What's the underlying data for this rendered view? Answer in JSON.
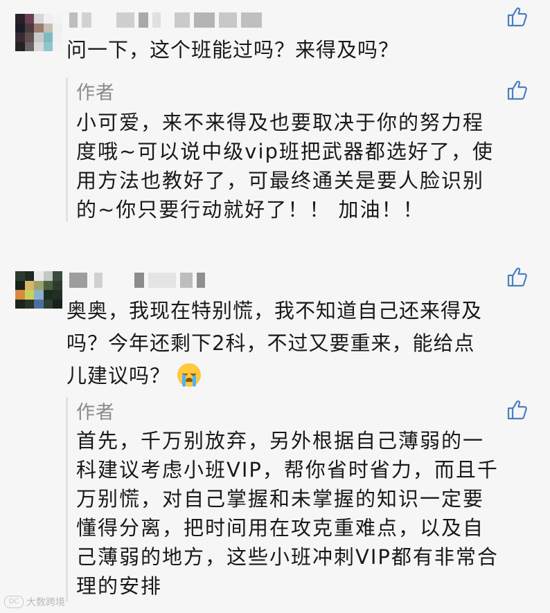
{
  "comments": [
    {
      "nickname": "",
      "text": "问一下，这个班能过吗？来得及吗？",
      "reply": {
        "author": "作者",
        "text": "小可爱，来不来得及也要取决于你的努力程\n度哦~可以说中级vip班把武器都选好了，使\n用方法也教好了，可最终通关是要人脸识别\n的~你只要行动就好了！！ 加油！！"
      }
    },
    {
      "nickname": "",
      "text_lines": [
        "奥奥，我现在特别慌，我不知道自己还来得及",
        "吗？今年还剩下2科，不过又要重来，能给点",
        "儿建议吗？"
      ],
      "emoji": "crying-face",
      "reply": {
        "author": "作者",
        "text": "首先，千万别放弃，另外根据自己薄弱的一\n科建议考虑小班VIP，帮你省时省力，而且千\n万别慌，对自己掌握和未掌握的知识一定要\n懂得分离，把时间用在攻克重难点，以及自\n己薄弱的地方，这些小班冲刺VIP都有非常合\n理的安排"
      }
    }
  ],
  "watermark": {
    "logo": "DC",
    "text": "大数跨境"
  },
  "colors": {
    "background": "#f6f6f6",
    "text": "#191919",
    "author": "#8a8a8a",
    "like_icon": "#4a7ec2",
    "reply_bar": "#e1e1e1"
  }
}
